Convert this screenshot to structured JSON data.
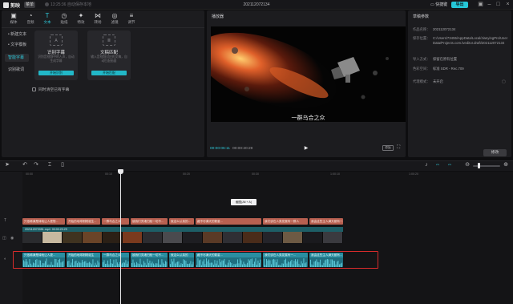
{
  "app": {
    "name": "剪映",
    "menu": "菜单",
    "autosave": "13:25:36 自动保存本地",
    "project_title": "202112072134",
    "shortcut": "快捷键",
    "export": "导出"
  },
  "tabs": [
    {
      "label": "媒体",
      "icon": "media-icon"
    },
    {
      "label": "音频",
      "icon": "audio-icon"
    },
    {
      "label": "文本",
      "icon": "text-icon",
      "active": true
    },
    {
      "label": "贴纸",
      "icon": "sticker-icon"
    },
    {
      "label": "特效",
      "icon": "effects-icon"
    },
    {
      "label": "转场",
      "icon": "transition-icon"
    },
    {
      "label": "滤镜",
      "icon": "filter-icon"
    },
    {
      "label": "调节",
      "icon": "adjust-icon"
    }
  ],
  "side_nav": [
    {
      "label": "• 新建文本"
    },
    {
      "label": "• 文字模板"
    },
    {
      "label": "智能字幕",
      "active": true
    },
    {
      "label": "识别歌词"
    }
  ],
  "cards": [
    {
      "title": "识别字幕",
      "desc": "识别音视频中的人声，自动生成字幕",
      "button": "开始识别"
    },
    {
      "title": "文稿匹配",
      "desc": "输入音视频对应的文稿，自动匹配画面",
      "button": "开始匹配"
    }
  ],
  "clear_checkbox": "同时清空已有字幕",
  "player": {
    "title": "播放器",
    "subtitle": "一群乌合之众",
    "time_current": "00:00:06:11",
    "time_total": "00:00:20:29",
    "ratio": "原始"
  },
  "params": {
    "title": "草稿参数",
    "rows": [
      {
        "k": "作品名称：",
        "v": "202112072134"
      },
      {
        "k": "保存位置：",
        "v": "C:/Users/73455/AppData/Local/JianyingPro/User Data/Projects.com.lveditor.draft/202112072134"
      },
      {
        "k": "导入方式：",
        "v": "保留在原有位置"
      },
      {
        "k": "色彩空间：",
        "v": "标准 SDR - Rec.709"
      },
      {
        "k": "代理模式：",
        "v": "未开启"
      }
    ],
    "modify": "修改"
  },
  "ruler": [
    "00:00",
    "00:10",
    "00:20",
    "00:30",
    "1:00:10",
    "1:00:20"
  ],
  "tooltip": "截图(Alt + A)",
  "text_clips": [
    "只依稀满是绿地让人更想...",
    "开始的地球刚刚诞生...",
    "一群乌合之众",
    "被我们灵魂归就一切不...",
    "就这么认真的...",
    "藏不尽满天的繁星...",
    "我们该在人类发展有一群人",
    "我由这些主人满天都有一..."
  ],
  "video_clip": {
    "name": "202112072051.mp4",
    "duration": "00:00:20:29"
  },
  "audio_clips": [
    "只依稀满是绿地让人更...",
    "开始的地球刚刚诞生",
    "一群乌合之众",
    "被我们灵魂归就一切不...",
    "就这么认真的",
    "藏不尽满天的繁星...",
    "我们该在人类发展有一...",
    "我由这些主人满天都有..."
  ],
  "colors": {
    "accent": "#2ec5d6",
    "text_track": "#b86050",
    "audio_track": "#1f6f80",
    "highlight": "#d62b2b"
  }
}
